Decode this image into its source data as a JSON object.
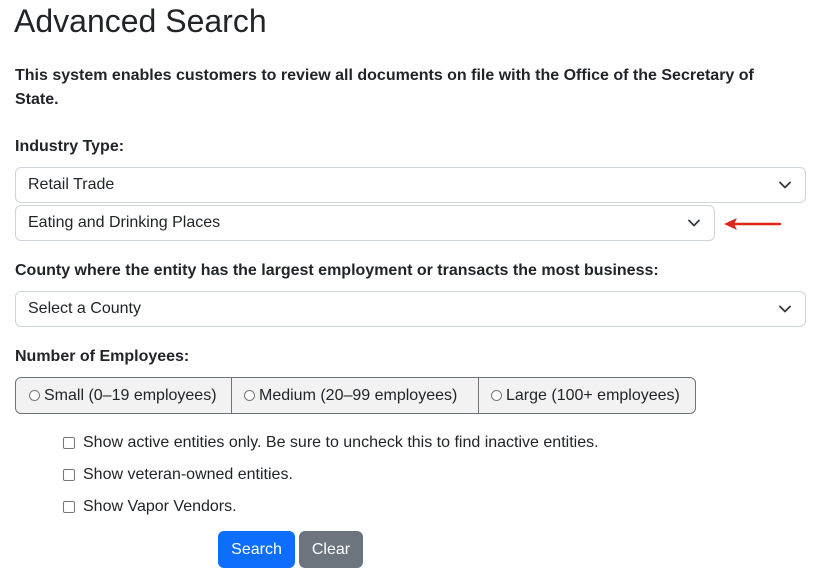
{
  "page": {
    "title": "Advanced Search",
    "intro": "This system enables customers to review all documents on file with the Office of the Secretary of State."
  },
  "industry": {
    "label": "Industry Type:",
    "selected_type": "Retail Trade",
    "selected_subtype": "Eating and Drinking Places"
  },
  "county": {
    "label": "County where the entity has the largest employment or transacts the most business:",
    "selected": "Select a County"
  },
  "employees": {
    "label": "Number of Employees:",
    "options": [
      "Small (0–19 employees)",
      "Medium (20–99 employees)",
      "Large (100+ employees)"
    ]
  },
  "filters": {
    "active_only": "Show active entities only. Be sure to uncheck this to find inactive entities.",
    "veteran_owned": "Show veteran-owned entities.",
    "vapor_vendors": "Show Vapor Vendors."
  },
  "actions": {
    "search_label": "Search",
    "clear_label": "Clear"
  },
  "colors": {
    "primary": "#0d6efd",
    "secondary": "#6c757d",
    "annotation_arrow": "#e0261b"
  },
  "icons": {
    "dropdown": "chevron-down-icon",
    "annotation": "red-arrow-icon"
  }
}
